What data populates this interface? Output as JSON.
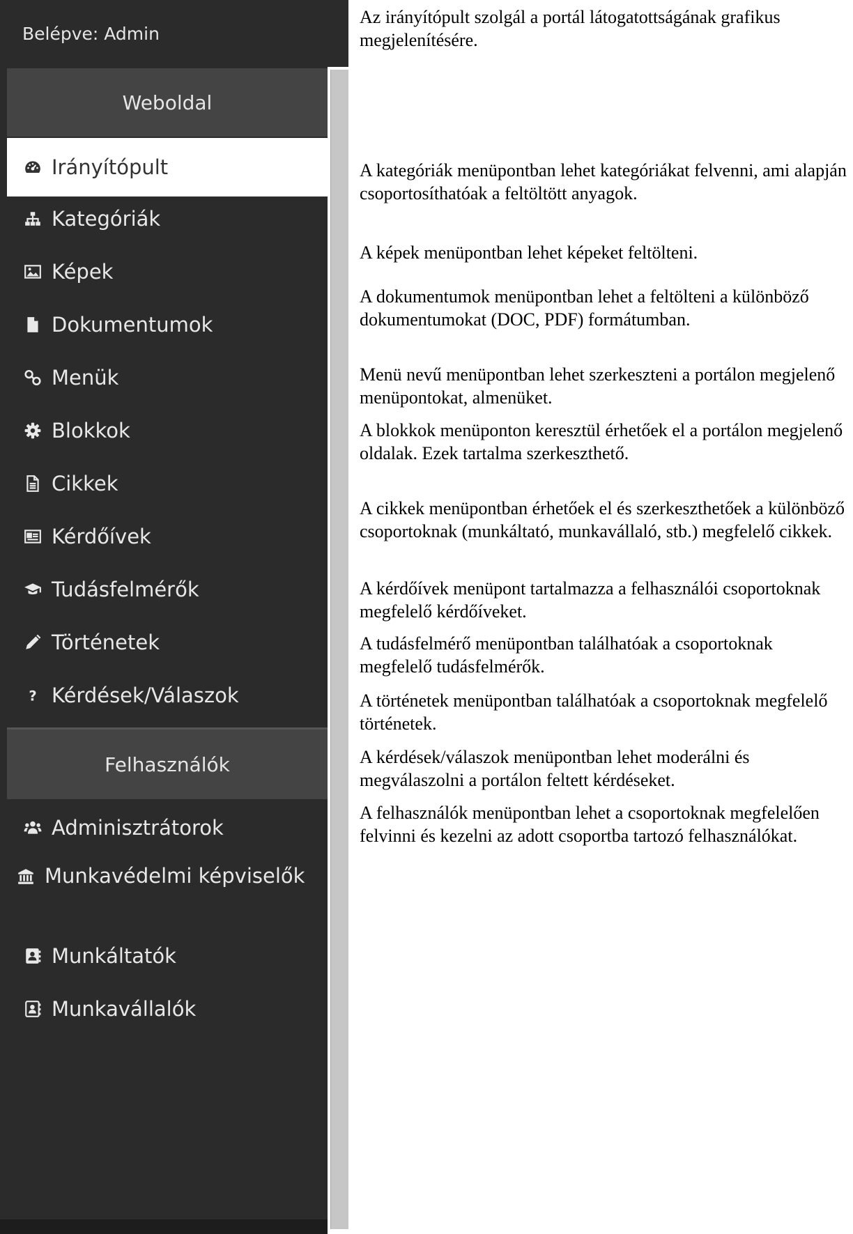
{
  "header": {
    "logged_in": "Belépve: Admin"
  },
  "colors": {
    "sidebar_bg": "#2b2b2b",
    "section_bg": "#444444",
    "active_bg": "#ffffff",
    "scrollbar": "#c6c6c6"
  },
  "sidebar": {
    "sections": [
      {
        "title": "Weboldal",
        "items": [
          {
            "label": "Irányítópult",
            "icon": "dashboard-icon",
            "active": true
          },
          {
            "label": "Kategóriák",
            "icon": "sitemap-icon"
          },
          {
            "label": "Képek",
            "icon": "image-icon"
          },
          {
            "label": "Dokumentumok",
            "icon": "file-icon"
          },
          {
            "label": "Menük",
            "icon": "link-icon"
          },
          {
            "label": "Blokkok",
            "icon": "gear-icon"
          },
          {
            "label": "Cikkek",
            "icon": "file-text-icon"
          },
          {
            "label": "Kérdőívek",
            "icon": "newspaper-icon"
          },
          {
            "label": "Tudásfelmérők",
            "icon": "graduation-cap-icon"
          },
          {
            "label": "Történetek",
            "icon": "pencil-icon"
          },
          {
            "label": "Kérdések/Válaszok",
            "icon": "question-icon"
          }
        ]
      },
      {
        "title": "Felhasználók",
        "items": [
          {
            "label": "Adminisztrátorok",
            "icon": "users-icon"
          },
          {
            "label": "Munkavédelmi képviselők",
            "icon": "institution-icon"
          },
          {
            "label": "Munkáltatók",
            "icon": "address-card-icon"
          },
          {
            "label": "Munkavállalók",
            "icon": "address-book-icon"
          }
        ]
      }
    ]
  },
  "descriptions": [
    "Az irányítópult szolgál a portál látogatottságának grafikus megjelenítésére.",
    "A kategóriák menüpontban lehet kategóriákat felvenni, ami alapján csoportosíthatóak a feltöltött anyagok.",
    "A képek menüpontban lehet képeket feltölteni.",
    "A dokumentumok menüpontban lehet a feltölteni a különböző dokumentumokat (DOC, PDF) formátumban.",
    "Menü nevű menüpontban lehet szerkeszteni a portálon megjelenő menüpontokat, almenüket.",
    "A blokkok menüponton keresztül érhetőek el a portálon megjelenő oldalak. Ezek tartalma szerkeszthető.",
    "A cikkek menüpontban érhetőek el és szerkeszthetőek a különböző csoportoknak (munkáltató, munkavállaló, stb.) megfelelő cikkek.",
    "A kérdőívek menüpont tartalmazza a felhasználói csoportoknak megfelelő kérdőíveket.",
    "A tudásfelmérő menüpontban találhatóak a csoportoknak megfelelő tudásfelmérők.",
    "A történetek menüpontban találhatóak a csoportoknak megfelelő történetek.",
    "A kérdések/válaszok menüpontban lehet moderálni és megválaszolni a portálon feltett kérdéseket.",
    "A felhasználók menüpontban lehet a csoportoknak megfelelően felvinni és kezelni az adott csoportba tartozó felhasználókat."
  ]
}
